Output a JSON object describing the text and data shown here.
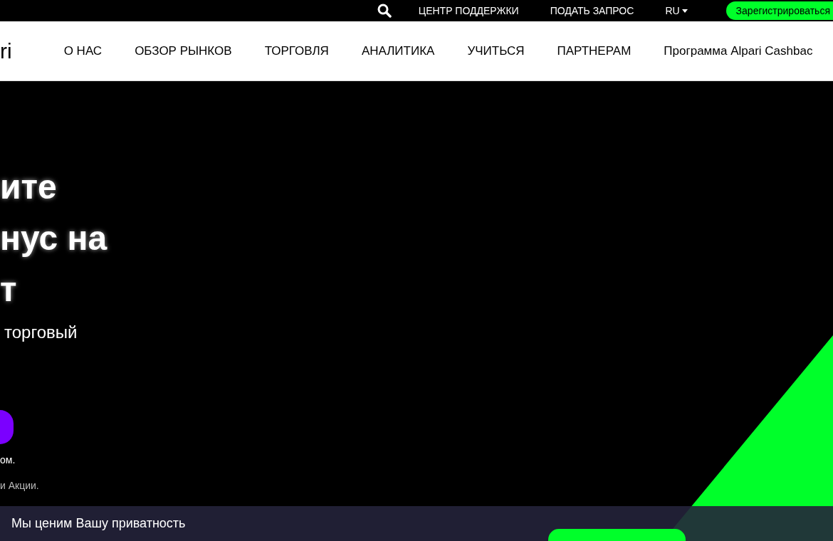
{
  "top_bar": {
    "links": [
      "ЦЕНТР ПОДДЕРЖКИ",
      "ПОДАТЬ ЗАПРОС"
    ],
    "language": "RU",
    "register_button": "Зарегистрироваться"
  },
  "nav": {
    "logo": "ri",
    "items": [
      "О НАС",
      "ОБЗОР РЫНКОВ",
      "ТОРГОВЛЯ",
      "АНАЛИТИКА",
      "УЧИТЬСЯ",
      "ПАРТНЕРАМ",
      "Программа Alpari Cashbac"
    ]
  },
  "hero": {
    "title_lines": [
      "ите",
      "нус на",
      "т"
    ],
    "subtitle": "торговый",
    "notes": [
      "ом.",
      "и Акции."
    ]
  },
  "cookie_banner": {
    "title": "Мы ценим Вашу приватность"
  }
}
